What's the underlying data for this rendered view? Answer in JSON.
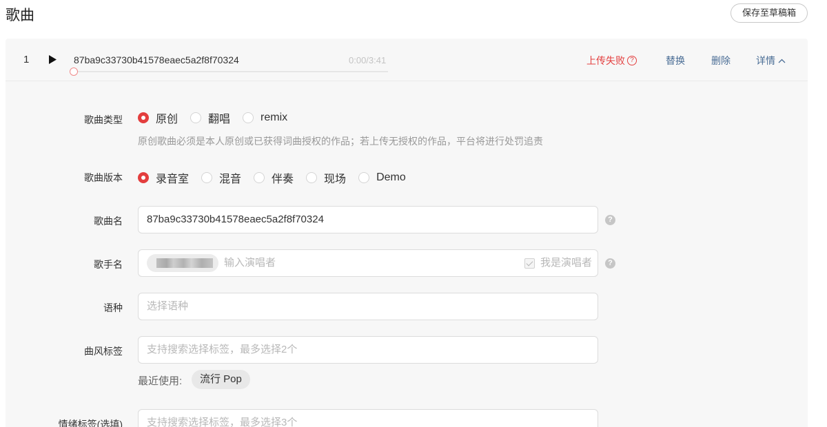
{
  "header": {
    "title": "歌曲",
    "save_draft_label": "保存至草稿箱"
  },
  "song": {
    "index": "1",
    "filename": "87ba9c33730b41578eaec5a2f8f70324",
    "time": "0:00/3:41",
    "progress": 0.0,
    "upload_status": "上传失败",
    "actions": {
      "replace": "替换",
      "delete": "删除",
      "details": "详情"
    }
  },
  "form": {
    "song_type": {
      "label": "歌曲类型",
      "options": [
        "原创",
        "翻唱",
        "remix"
      ],
      "selected": "原创",
      "hint": "原创歌曲必须是本人原创或已获得词曲授权的作品；若上传无授权的作品，平台将进行处罚追责"
    },
    "song_version": {
      "label": "歌曲版本",
      "options": [
        "录音室",
        "混音",
        "伴奏",
        "现场",
        "Demo"
      ],
      "selected": "录音室"
    },
    "song_name": {
      "label": "歌曲名",
      "value": "87ba9c33730b41578eaec5a2f8f70324"
    },
    "artist": {
      "label": "歌手名",
      "placeholder": "输入演唱者",
      "self_label": "我是演唱者",
      "self_checked": true
    },
    "language": {
      "label": "语种",
      "placeholder": "选择语种"
    },
    "genre": {
      "label": "曲风标签",
      "placeholder": "支持搜索选择标签，最多选择2个",
      "recent_label": "最近使用:",
      "recent_tags": [
        "流行 Pop"
      ]
    },
    "mood": {
      "label": "情绪标签(选填)",
      "placeholder": "支持搜索选择标签，最多选择3个"
    }
  },
  "colors": {
    "accent_red": "#e33e3e",
    "link_blue": "#4a6d95",
    "panel_bg": "#f7f7f7"
  }
}
